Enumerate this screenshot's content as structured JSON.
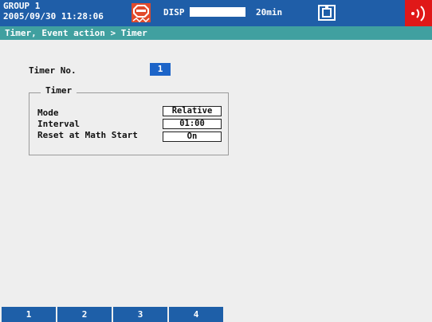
{
  "status_bar": {
    "group": "GROUP 1",
    "datetime": "2005/09/30 11:28:06",
    "stop_icon": "stop-recording-icon",
    "disp_label": "DISP",
    "disp_time": "20min",
    "media_icon": "memory-card-icon",
    "alarm_icon": "alarm-signal-icon"
  },
  "breadcrumb": "Timer, Event action > Timer",
  "timer_no": {
    "label": "Timer No.",
    "value": "1"
  },
  "timer_group": {
    "title": "Timer",
    "rows": [
      {
        "label": "Mode",
        "value": "Relative"
      },
      {
        "label": "Interval",
        "value": "01:00"
      },
      {
        "label": "Reset at Math Start",
        "value": "On"
      }
    ]
  },
  "softkeys": [
    "1",
    "2",
    "3",
    "4"
  ],
  "colors": {
    "status_bar": "#1f5ea8",
    "breadcrumb": "#40a0a0",
    "highlight": "#1c64c8",
    "alarm": "#e01818"
  }
}
